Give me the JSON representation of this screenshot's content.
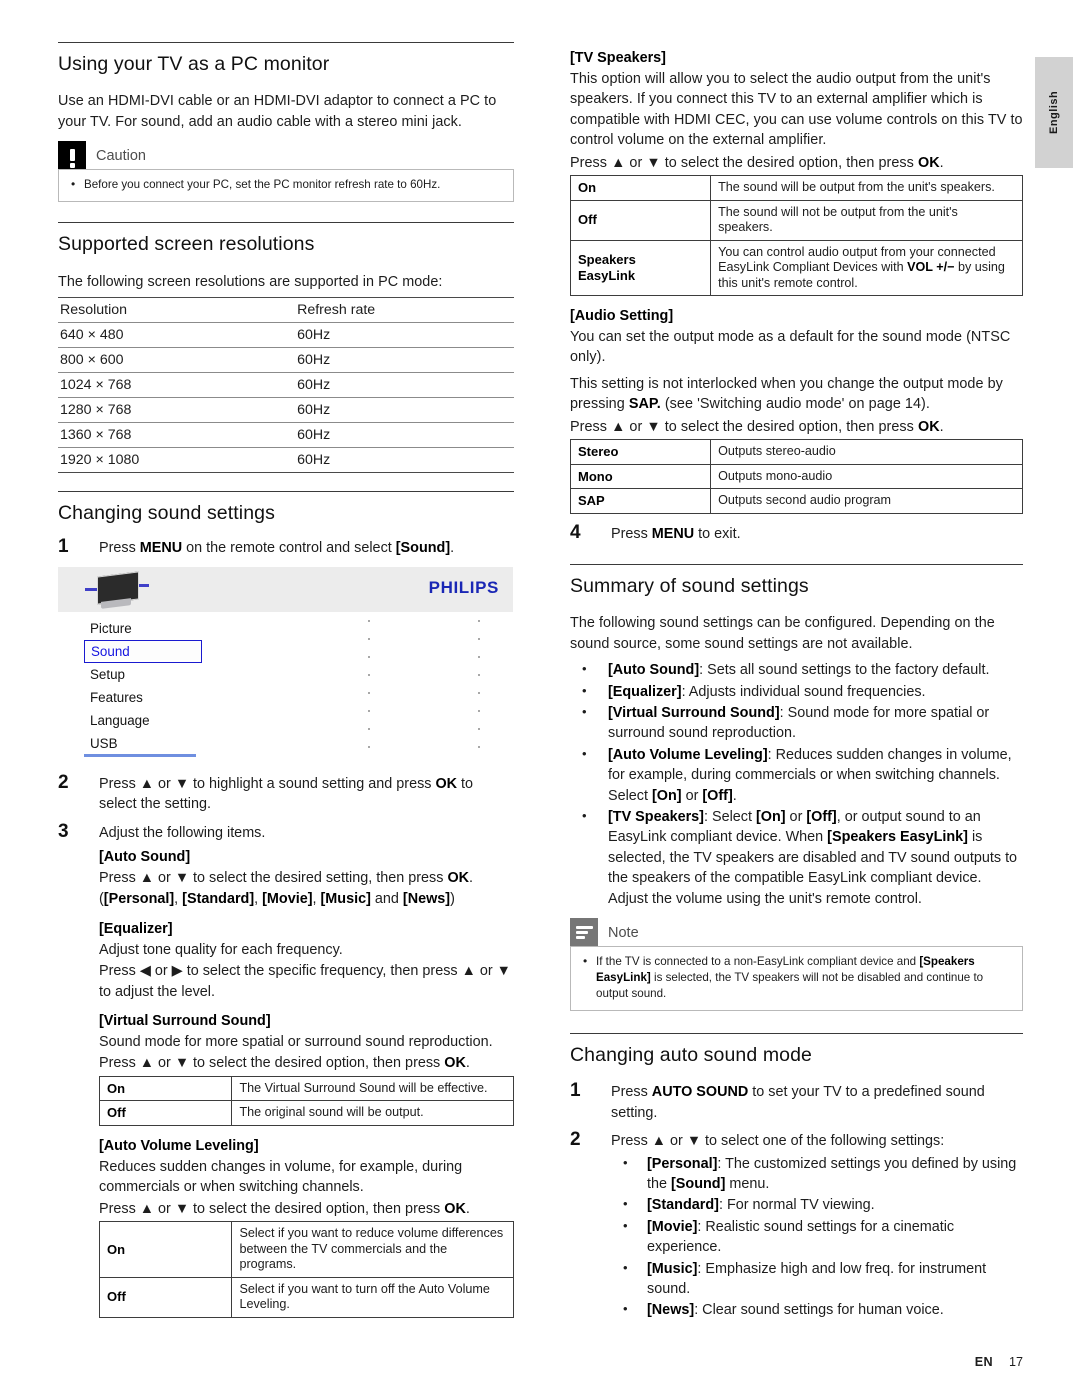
{
  "language_tab": "English",
  "footer": {
    "lang_code": "EN",
    "page_number": "17"
  },
  "left_column": {
    "section_pc_monitor": {
      "heading": "Using your TV as a PC monitor",
      "paragraph": "Use an HDMI-DVI cable or an HDMI-DVI adaptor to connect a PC to your TV. For sound, add an audio cable with a stereo mini jack.",
      "caution": {
        "title": "Caution",
        "icon": "exclamation-icon",
        "items": [
          "Before you connect your PC, set the PC monitor refresh rate to 60Hz."
        ]
      }
    },
    "section_resolutions": {
      "heading": "Supported screen resolutions",
      "intro": "The following screen resolutions are supported in PC mode:",
      "table": {
        "headers": [
          "Resolution",
          "Refresh rate"
        ],
        "rows": [
          [
            "640 × 480",
            "60Hz"
          ],
          [
            "800 × 600",
            "60Hz"
          ],
          [
            "1024 × 768",
            "60Hz"
          ],
          [
            "1280 × 768",
            "60Hz"
          ],
          [
            "1360 × 768",
            "60Hz"
          ],
          [
            "1920 × 1080",
            "60Hz"
          ]
        ]
      }
    },
    "section_changing_sound": {
      "heading": "Changing sound settings",
      "step1_number": "1",
      "step1_prefix": "Press ",
      "step1_key": "MENU",
      "step1_mid": " on the remote control and select ",
      "step1_target": "[Sound]",
      "step1_suffix": ".",
      "osd": {
        "brand": "PHILIPS",
        "icon": "tv-icon",
        "items": [
          "Picture",
          "Sound",
          "Setup",
          "Features",
          "Language",
          "USB"
        ],
        "selected": "Sound"
      },
      "step2_number": "2",
      "step2_text_a": "Press ▲ or ▼ to highlight a sound setting and press ",
      "step2_key": "OK",
      "step2_text_b": " to select the setting.",
      "step3_number": "3",
      "step3_text": "Adjust the following items.",
      "items": {
        "auto_sound": {
          "label": "[Auto Sound]",
          "line1_a": "Press ▲ or ▼ to select the desired setting, then press ",
          "line1_key": "OK",
          "line1_b": ".",
          "line2": "([Personal], [Standard], [Movie], [Music] and [News])",
          "line2_parts": [
            "([",
            "Personal",
            "], [",
            "Standard",
            "], [",
            "Movie",
            "], [",
            "Music",
            "] and [",
            "News",
            "])"
          ]
        },
        "equalizer": {
          "label": "[Equalizer]",
          "line1": "Adjust tone quality for each frequency.",
          "line2": "Press ◀ or ▶ to select the specific frequency, then press ▲ or ▼ to adjust the level."
        },
        "virtual_surround": {
          "label": "[Virtual Surround Sound]",
          "line1": "Sound mode for more spatial or surround sound reproduction.",
          "line2_a": "Press ▲ or ▼ to select the desired option, then press ",
          "line2_key": "OK",
          "line2_b": ".",
          "table": [
            [
              "On",
              "The Virtual Surround Sound will be effective."
            ],
            [
              "Off",
              "The original sound will be output."
            ]
          ]
        },
        "auto_volume_leveling": {
          "label": "[Auto Volume Leveling]",
          "line1": "Reduces sudden changes in volume, for example, during commercials or when switching channels.",
          "line2_a": "Press ▲ or ▼ to select the desired option, then press ",
          "line2_key": "OK",
          "line2_b": ".",
          "table": [
            [
              "On",
              "Select if you want to reduce volume differences between the TV commercials and the programs."
            ],
            [
              "Off",
              "Select if you want to turn off the Auto Volume Leveling."
            ]
          ]
        }
      }
    }
  },
  "right_column": {
    "tv_speakers": {
      "label": "[TV Speakers]",
      "paragraph": "This option will allow you to select the audio output from the unit's speakers. If you connect this TV to an external amplifier which is compatible with HDMI CEC, you can use volume controls on this TV to control volume on the external amplifier.",
      "press_a": "Press ▲ or ▼ to select the desired option, then press ",
      "press_key": "OK",
      "press_b": ".",
      "table": [
        [
          "On",
          "The sound will be output from the unit's speakers."
        ],
        [
          "Off",
          "The sound will not be output from the unit's speakers."
        ],
        [
          "Speakers EasyLink",
          "You can control audio output from your connected EasyLink Compliant Devices with VOL +/− by using this unit's remote control."
        ]
      ],
      "row3_key_line1": "Speakers",
      "row3_key_line2": "EasyLink",
      "row3_desc_a": "You can control audio output from your connected EasyLink Compliant Devices with ",
      "row3_desc_key": "VOL +/−",
      "row3_desc_b": " by using this unit's remote control."
    },
    "audio_setting": {
      "label": "[Audio Setting]",
      "para1": "You can set the output mode as a default for the sound mode (NTSC only).",
      "para2_a": "This setting is not interlocked when you change the output mode by pressing ",
      "para2_key": "SAP.",
      "para2_b": " (see 'Switching audio mode' on page 14).",
      "press_a": "Press ▲ or ▼ to select the desired option, then press ",
      "press_key": "OK",
      "press_b": ".",
      "table": [
        [
          "Stereo",
          "Outputs stereo-audio"
        ],
        [
          "Mono",
          "Outputs mono-audio"
        ],
        [
          "SAP",
          "Outputs second audio program"
        ]
      ]
    },
    "step4": {
      "number": "4",
      "text_a": "Press ",
      "key": "MENU",
      "text_b": " to exit."
    },
    "summary": {
      "heading": "Summary of sound settings",
      "intro": "The following sound settings can be configured. Depending on the sound source, some sound settings are not available.",
      "bullets": [
        {
          "term": "[Auto Sound]",
          "desc": ": Sets all sound settings to the factory default."
        },
        {
          "term": "[Equalizer]",
          "desc": ": Adjusts individual sound frequencies."
        },
        {
          "term": "[Virtual Surround Sound]",
          "desc": ": Sound mode for more spatial or surround sound reproduction."
        },
        {
          "term": "[Auto Volume Leveling]",
          "desc": ": Reduces sudden changes in volume, for example, during commercials or when switching channels. Select [On] or [Off]."
        },
        {
          "term": "[TV Speakers]",
          "desc": ": Select [On] or [Off], or output sound to an EasyLink compliant device. When [Speakers EasyLink] is selected, the TV speakers are disabled and TV sound outputs to the speakers of the compatible EasyLink compliant device. Adjust the volume using the unit's remote control."
        }
      ],
      "note": {
        "title": "Note",
        "icon": "note-lines-icon",
        "items": [
          "If the TV is connected to a non-EasyLink compliant device and [Speakers EasyLink] is selected, the TV speakers will not be disabled and continue to output sound."
        ]
      }
    },
    "auto_sound_mode": {
      "heading": "Changing auto sound mode",
      "step1_number": "1",
      "step1_a": "Press ",
      "step1_key": "AUTO SOUND",
      "step1_b": " to set your TV to a predefined sound setting.",
      "step2_number": "2",
      "step2_text": "Press ▲ or ▼ to select one of the following settings:",
      "bullets": [
        {
          "term": "[Personal]",
          "desc": ": The customized settings you defined by using the [Sound] menu."
        },
        {
          "term": "[Standard]",
          "desc": ": For normal TV viewing."
        },
        {
          "term": "[Movie]",
          "desc": ": Realistic sound settings for a cinematic experience."
        },
        {
          "term": "[Music]",
          "desc": ": Emphasize high and low freq. for instrument sound."
        },
        {
          "term": "[News]",
          "desc": ": Clear sound settings for human voice."
        }
      ]
    }
  }
}
